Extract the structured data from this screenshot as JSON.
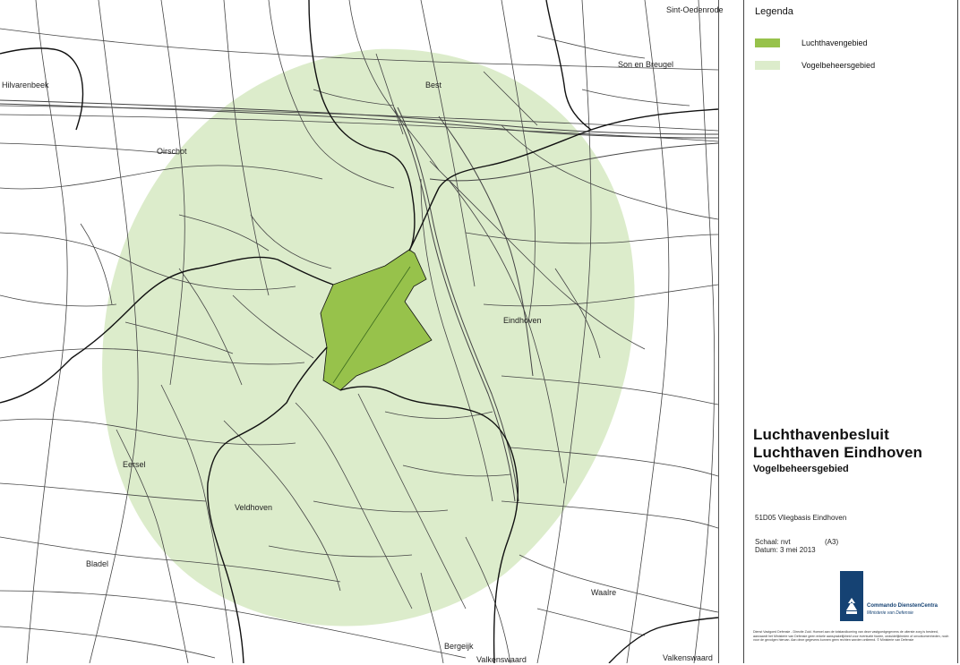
{
  "map": {
    "colors": {
      "luchthaven": "#97c24b",
      "vogelbeheer": "#dceccb",
      "roads": "#444444",
      "boundaries": "#111111"
    },
    "places": [
      {
        "name": "Sint-Oedenrode",
        "id": "sint-oedenrode"
      },
      {
        "name": "Son en Breugel",
        "id": "son-en-breugel"
      },
      {
        "name": "Hilvarenbeek",
        "id": "hilvarenbeek"
      },
      {
        "name": "Best",
        "id": "best"
      },
      {
        "name": "Oirschot",
        "id": "oirschot"
      },
      {
        "name": "Eindhoven",
        "id": "eindhoven"
      },
      {
        "name": "Eersel",
        "id": "eersel"
      },
      {
        "name": "Veldhoven",
        "id": "veldhoven"
      },
      {
        "name": "Bladel",
        "id": "bladel"
      },
      {
        "name": "Waalre",
        "id": "waalre"
      },
      {
        "name": "Bergeijk",
        "id": "bergeijk"
      },
      {
        "name": "Valkenswaard",
        "id": "valkenswaard-1"
      },
      {
        "name": "Valkenswaard",
        "id": "valkenswaard-2"
      }
    ]
  },
  "legend": {
    "title": "Legenda",
    "items": [
      {
        "label": "Luchthavengebied",
        "color": "#97c24b"
      },
      {
        "label": "Vogelbeheersgebied",
        "color": "#dceccb"
      }
    ]
  },
  "panel": {
    "title_line1": "Luchthavenbesluit",
    "title_line2": "Luchthaven Eindhoven",
    "subtitle": "Vogelbeheersgebied",
    "code": "51D05  Vliegbasis Eindhoven",
    "scale_label": "Schaal: nvt",
    "paper": "(A3)",
    "date_label": "Datum:  3 mei 2013",
    "logo_line1": "Commando DienstenCentra",
    "logo_line2": "Ministerie van Defensie",
    "disclaimer": "Dienst Vastgoed Defensie - Directie Zuid. Hoewel aan de totstandkoming van deze vastgoedgegevens de uiterste zorg is besteed, aanvaardt het Ministerie van Defensie geen enkele aansprakelijkheid voor eventuele fouten, onduidelijkheden of onvolkomenheden, noch voor de gevolgen hiervan. Aan deze gegevens kunnen geen rechten worden ontleend. © Ministerie van Defensie"
  }
}
